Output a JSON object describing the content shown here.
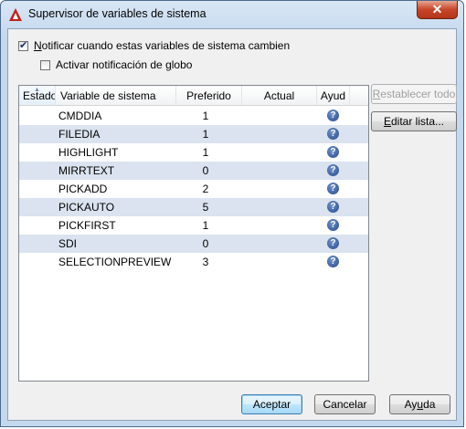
{
  "window": {
    "title": "Supervisor de variables de sistema",
    "close_glyph": "✕"
  },
  "options": {
    "notify": {
      "label": "Notificar cuando estas variables de sistema cambien",
      "checked": true
    },
    "balloon": {
      "label": "Activar notificación de globo",
      "checked": false
    }
  },
  "list": {
    "columns": [
      "Estado",
      "Variable de sistema",
      "Preferido",
      "Actual",
      "Ayud"
    ],
    "rows": [
      {
        "name": "CMDDIA",
        "preferred": "1",
        "current": ""
      },
      {
        "name": "FILEDIA",
        "preferred": "1",
        "current": ""
      },
      {
        "name": "HIGHLIGHT",
        "preferred": "1",
        "current": ""
      },
      {
        "name": "MIRRTEXT",
        "preferred": "0",
        "current": ""
      },
      {
        "name": "PICKADD",
        "preferred": "2",
        "current": ""
      },
      {
        "name": "PICKAUTO",
        "preferred": "5",
        "current": ""
      },
      {
        "name": "PICKFIRST",
        "preferred": "1",
        "current": ""
      },
      {
        "name": "SDI",
        "preferred": "0",
        "current": ""
      },
      {
        "name": "SELECTIONPREVIEW",
        "preferred": "3",
        "current": ""
      }
    ],
    "help_icon": "help-icon",
    "help_glyph": "?"
  },
  "side_buttons": {
    "reset": "Restablecer todo",
    "edit": "Editar lista..."
  },
  "footer": {
    "ok": "Aceptar",
    "cancel": "Cancelar",
    "help": "Ayuda"
  },
  "colors": {
    "alt_row": "#dae3ef",
    "close_red": "#c7452a",
    "help_blue": "#244a8c"
  }
}
